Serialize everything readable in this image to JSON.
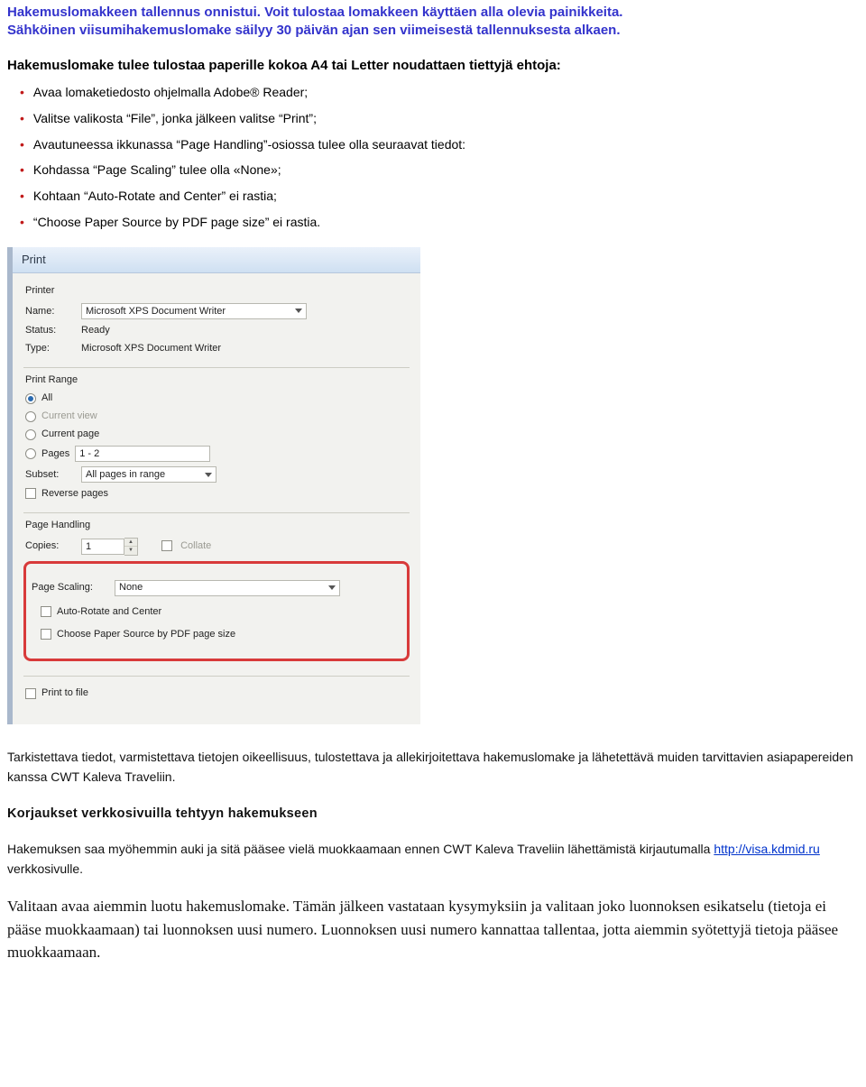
{
  "notice": {
    "line1": "Hakemuslomakkeen tallennus onnistui. Voit tulostaa lomakkeen käyttäen alla olevia painikkeita.",
    "line2": "Sähköinen viisumihakemuslomake säilyy 30 päivän ajan sen viimeisestä tallennuksesta alkaen."
  },
  "heading": "Hakemuslomake tulee tulostaa paperille kokoa A4 tai Letter noudattaen tiettyjä ehtoja:",
  "instructions": [
    "Avaa lomaketiedosto ohjelmalla Adobe® Reader;",
    "Valitse valikosta “File”, jonka jälkeen valitse “Print”;",
    "Avautuneessa ikkunassa “Page Handling”-osiossa tulee olla seuraavat tiedot:",
    "Kohdassa “Page Scaling” tulee olla «None»;",
    "Kohtaan “Auto-Rotate and Center” ei rastia;",
    "“Choose Paper Source by PDF page size” ei rastia."
  ],
  "dialog": {
    "title": "Print",
    "printer": {
      "section": "Printer",
      "name_label": "Name:",
      "name_value": "Microsoft XPS Document Writer",
      "status_label": "Status:",
      "status_value": "Ready",
      "type_label": "Type:",
      "type_value": "Microsoft XPS Document Writer"
    },
    "print_range": {
      "section": "Print Range",
      "all": "All",
      "current_view": "Current view",
      "current_page": "Current page",
      "pages": "Pages",
      "pages_value": "1 - 2",
      "subset_label": "Subset:",
      "subset_value": "All pages in range",
      "reverse_pages": "Reverse pages"
    },
    "page_handling": {
      "section": "Page Handling",
      "copies_label": "Copies:",
      "copies_value": "1",
      "collate": "Collate",
      "page_scaling_label": "Page Scaling:",
      "page_scaling_value": "None",
      "auto_rotate": "Auto-Rotate and Center",
      "choose_paper": "Choose Paper Source by PDF page size"
    },
    "print_to_file": "Print to file"
  },
  "body": {
    "para1": "Tarkistettava tiedot, varmistettava tietojen oikeellisuus, tulostettava ja allekirjoitettava hakemuslomake ja lähetettävä muiden tarvittavien asiapapereiden kanssa CWT Kaleva Traveliin.",
    "subhead": "Korjaukset verkkosivuilla tehtyyn hakemukseen",
    "para2_a": "Hakemuksen saa myöhemmin auki ja sitä pääsee vielä muokkaamaan ennen CWT Kaleva Traveliin lähettämistä kirjautumalla ",
    "para2_link": "http://visa.kdmid.ru",
    "para2_b": " verkkosivulle.",
    "para3": "Valitaan avaa aiemmin luotu hakemuslomake. Tämän jälkeen vastataan kysymyksiin ja valitaan joko luonnoksen esikatselu (tietoja ei pääse muokkaamaan) tai luonnoksen uusi numero. Luonnoksen uusi numero kannattaa tallentaa, jotta aiemmin syötettyjä tietoja pääsee muokkaamaan."
  }
}
